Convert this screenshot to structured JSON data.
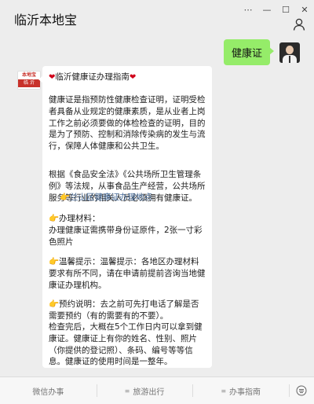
{
  "header": {
    "title": "临沂本地宝"
  },
  "outgoing": {
    "text": "健康证"
  },
  "bot": {
    "avatar_top": "本地宝",
    "avatar_bottom": "临 沂",
    "heading_text": "临沂健康证办理指南",
    "intro": "健康证是指预防性健康检查证明，证明受检者具备从业规定的健康素质，是从业者上岗工作之前必须要做的体检检查的证明，目的是为了预防、控制和消除传染病的发生与流行，保障人体健康和公共卫生。",
    "law": "根据《食品安全法》《公共场所卫生管理条例》等法规，从事食品生产经营，公共场所服务等行业的相关人员必须拥有健康证。",
    "link_text": "兰山区健康证办理地点",
    "materials_title": "办理材料：",
    "materials": "办理健康证需携带身份证原件，2张一寸彩色照片",
    "tip": "温馨提示：温馨提示：各地区办理材料要求有所不同，请在申请前提前咨询当地健康证办理机构。",
    "appointment": "预约说明：去之前可先打电话了解是否需要预约（有的需要有的不要）。",
    "after_check": "检查完后，大概在5个工作日内可以拿到健康证。健康证上有你的姓名、性别、照片（你提供的登记照）、条码、编号等等信息。健康证的使用时间是一整年。"
  },
  "menu": {
    "items": [
      "微信办事",
      "旅游出行",
      "办事指南"
    ]
  },
  "icons": {
    "heart": "heart-icon",
    "hand": "pointing-hand-icon",
    "person": "person-icon",
    "keyboard": "keyboard-icon",
    "menu_lines": "menu-lines-icon"
  },
  "colors": {
    "outgoing_bubble": "#95ec69",
    "link": "#4a6e9b",
    "heart": "#d0021b",
    "hand": "#e8a13a",
    "brand_red": "#c8322b"
  }
}
